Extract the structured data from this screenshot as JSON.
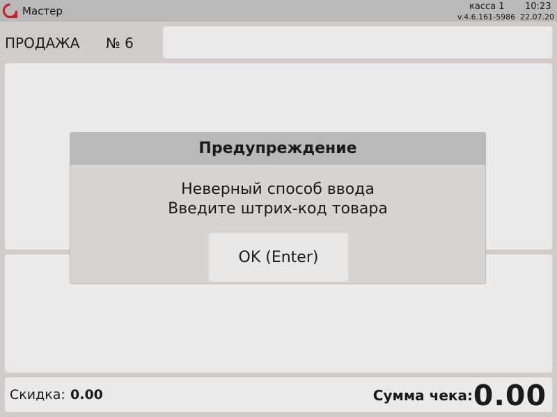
{
  "topbar": {
    "logo_icon": "cashier-logo-icon",
    "user": "Мастер",
    "register": "касса 1",
    "time": "10:23",
    "version": "v.4.6.161-5986",
    "date": "22.07.20"
  },
  "document": {
    "type": "ПРОДАЖА",
    "number": "№ 6"
  },
  "footer": {
    "discount_label": "Скидка:",
    "discount_value": "0.00",
    "total_label": "Сумма чека:",
    "total_value": "0.00"
  },
  "dialog": {
    "title": "Предупреждение",
    "message_line1": "Неверный способ ввода",
    "message_line2": "Введите штрих-код товара",
    "ok_label": "OK (Enter)"
  },
  "colors": {
    "background": "#d1ccc9",
    "bar": "#b9b9b9",
    "panel": "#eaeaea",
    "logo": "#c8202d"
  }
}
